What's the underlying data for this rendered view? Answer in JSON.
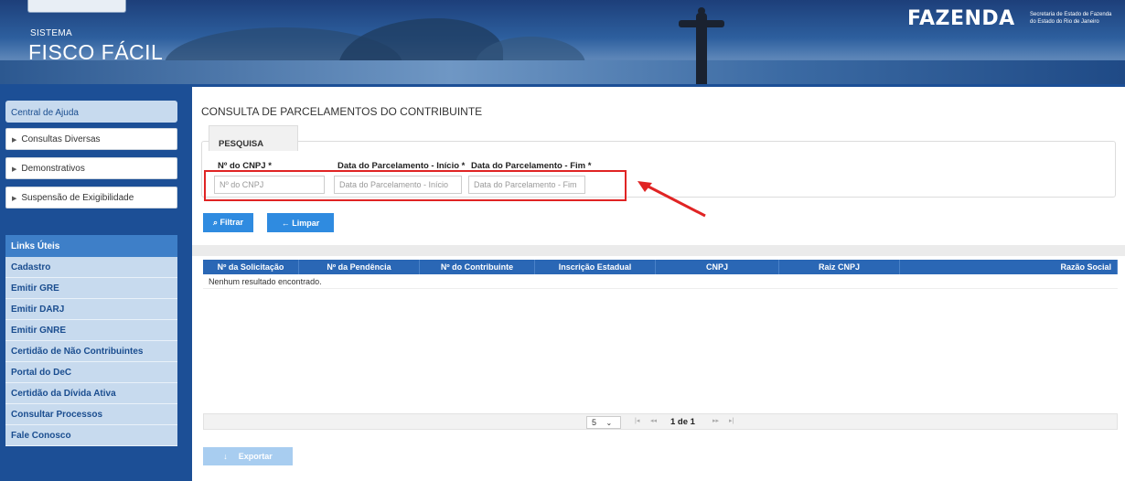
{
  "header": {
    "system_label": "SISTEMA",
    "system_name": "FISCO FÁCIL",
    "agency_logo": "FAZENDA",
    "agency_sub_line1": "Secretaria de Estado de Fazenda",
    "agency_sub_line2": "do Estado do Rio de Janeiro"
  },
  "sidebar": {
    "help": "Central de Ajuda",
    "items": [
      {
        "label": "Consultas Diversas"
      },
      {
        "label": "Demonstrativos"
      },
      {
        "label": "Suspensão de Exigibilidade"
      }
    ],
    "links_title": "Links Úteis",
    "links": [
      "Cadastro",
      "Emitir GRE",
      "Emitir DARJ",
      "Emitir GNRE",
      "Certidão de Não Contribuintes",
      "Portal do DeC",
      "Certidão da Dívida Ativa",
      "Consultar Processos",
      "Fale Conosco"
    ]
  },
  "main": {
    "title": "CONSULTA DE PARCELAMENTOS DO CONTRIBUINTE",
    "tab": "PESQUISA",
    "fields": {
      "cnpj_label": "Nº do CNPJ *",
      "cnpj_placeholder": "Nº do CNPJ",
      "start_label": "Data do Parcelamento - Início *",
      "start_placeholder": "Data do Parcelamento - Início",
      "end_label": "Data do Parcelamento - Fim *",
      "end_placeholder": "Data do Parcelamento - Fim"
    },
    "buttons": {
      "filter": "Filtrar",
      "clear": "Limpar",
      "export": "Exportar"
    },
    "table": {
      "columns": [
        "Nº da Solicitação",
        "Nº da Pendência",
        "Nº do Contribuinte",
        "Inscrição Estadual",
        "CNPJ",
        "Raiz CNPJ",
        "Razão Social"
      ],
      "empty_message": "Nenhum resultado encontrado."
    },
    "pager": {
      "page_size": "5",
      "page_info": "1 de 1"
    }
  },
  "colors": {
    "accent": "#2f8be0",
    "highlight": "#e02424",
    "table_header": "#2a67b5"
  }
}
